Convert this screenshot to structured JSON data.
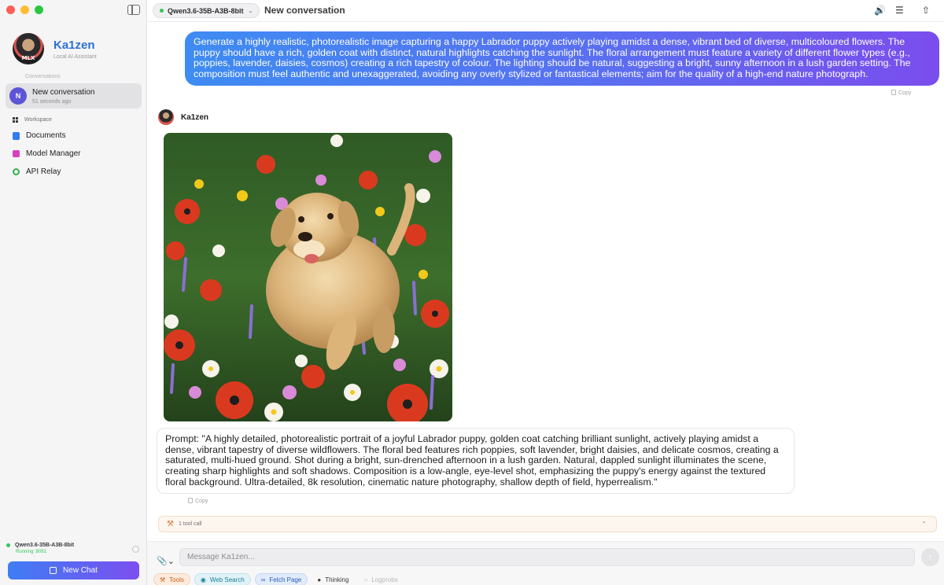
{
  "sidebar": {
    "brand_name": "Ka1zen",
    "brand_subtitle": "Local AI Assistant",
    "conversations_label": "Conversations",
    "conversation": {
      "avatar_letter": "N",
      "title": "New conversation",
      "time": "51 seconds ago"
    },
    "workspace_label": "Workspace",
    "items": [
      {
        "label": "Documents",
        "icon": "document-icon"
      },
      {
        "label": "Model Manager",
        "icon": "model-manager-icon"
      },
      {
        "label": "API Relay",
        "icon": "api-relay-icon"
      }
    ],
    "status_model": "Qwen3.6-35B-A3B-8bit",
    "status_running": "Running :8081",
    "new_chat_label": "New Chat"
  },
  "topbar": {
    "model_name": "Qwen3.6-35B-A3B-8bit",
    "title": "New conversation"
  },
  "chat": {
    "user_message": "Generate a highly realistic, photorealistic image capturing a happy Labrador puppy actively playing amidst a dense, vibrant bed of diverse, multicoloured flowers. The puppy should have a rich, golden coat with distinct, natural highlights catching the sunlight. The floral arrangement must feature a variety of different flower types (e.g., poppies, lavender, daisies, cosmos) creating a rich tapestry of colour. The lighting should be natural, suggesting a bright, sunny afternoon in a lush garden setting. The composition must feel authentic and unexaggerated, avoiding any overly stylized or fantastical elements; aim for the quality of a high-end nature photograph.",
    "copy_label": "Copy",
    "assistant_name": "Ka1zen",
    "prompt_text": "Prompt: \"A highly detailed, photorealistic portrait of a joyful Labrador puppy, golden coat catching brilliant sunlight, actively playing amidst a dense, vibrant tapestry of diverse wildflowers. The floral bed features rich poppies, soft lavender, bright daisies, and delicate cosmos, creating a saturated, multi-hued ground. Shot during a bright, sun-drenched afternoon in a lush garden. Natural, dappled sunlight illuminates the scene, creating sharp highlights and soft shadows. Composition is a low-angle, eye-level shot, emphasizing the puppy's energy against the textured floral background. Ultra-detailed, 8k resolution, cinematic nature photography, shallow depth of field, hyperrealism.\"",
    "tool_call_label": "1 tool call"
  },
  "composer": {
    "placeholder": "Message Ka1zen...",
    "chips": {
      "tools": "Tools",
      "web_search": "Web Search",
      "fetch_page": "Fetch Page",
      "thinking": "Thinking",
      "logprobs": "Logprobs"
    }
  },
  "colors": {
    "accent_blue": "#3e8cf2",
    "accent_purple": "#7b4ded",
    "running_green": "#34c759"
  }
}
